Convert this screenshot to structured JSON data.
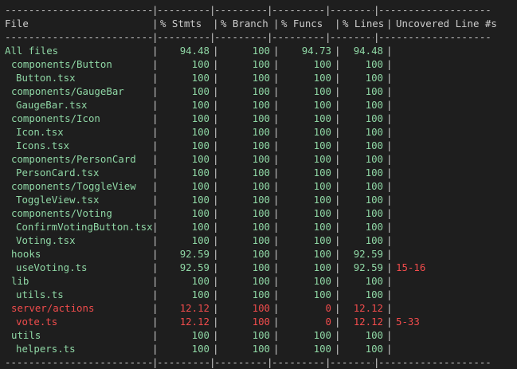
{
  "colors": {
    "background": "#1e1e1e",
    "default_text": "#cccccc",
    "covered": "#8fd7a5",
    "uncovered": "#f14c4c"
  },
  "table": {
    "separator": {
      "file": "--------------------------",
      "stmts": "---------",
      "branch": "----------",
      "funcs": "---------",
      "lines": "---------",
      "uncovered": "-------------------"
    },
    "headers": {
      "file": "File",
      "stmts": "% Stmts",
      "branch": "% Branch",
      "funcs": "% Funcs",
      "lines": "% Lines",
      "uncovered": "Uncovered Line #s"
    },
    "rows": [
      {
        "file": "All files",
        "indent": 0,
        "stmts": "94.48",
        "branch": "100",
        "funcs": "94.73",
        "lines": "94.48",
        "uncovered": "",
        "status": "ok"
      },
      {
        "file": "components/Button",
        "indent": 1,
        "stmts": "100",
        "branch": "100",
        "funcs": "100",
        "lines": "100",
        "uncovered": "",
        "status": "ok"
      },
      {
        "file": "Button.tsx",
        "indent": 2,
        "stmts": "100",
        "branch": "100",
        "funcs": "100",
        "lines": "100",
        "uncovered": "",
        "status": "ok"
      },
      {
        "file": "components/GaugeBar",
        "indent": 1,
        "stmts": "100",
        "branch": "100",
        "funcs": "100",
        "lines": "100",
        "uncovered": "",
        "status": "ok"
      },
      {
        "file": "GaugeBar.tsx",
        "indent": 2,
        "stmts": "100",
        "branch": "100",
        "funcs": "100",
        "lines": "100",
        "uncovered": "",
        "status": "ok"
      },
      {
        "file": "components/Icon",
        "indent": 1,
        "stmts": "100",
        "branch": "100",
        "funcs": "100",
        "lines": "100",
        "uncovered": "",
        "status": "ok"
      },
      {
        "file": "Icon.tsx",
        "indent": 2,
        "stmts": "100",
        "branch": "100",
        "funcs": "100",
        "lines": "100",
        "uncovered": "",
        "status": "ok"
      },
      {
        "file": "Icons.tsx",
        "indent": 2,
        "stmts": "100",
        "branch": "100",
        "funcs": "100",
        "lines": "100",
        "uncovered": "",
        "status": "ok"
      },
      {
        "file": "components/PersonCard",
        "indent": 1,
        "stmts": "100",
        "branch": "100",
        "funcs": "100",
        "lines": "100",
        "uncovered": "",
        "status": "ok"
      },
      {
        "file": "PersonCard.tsx",
        "indent": 2,
        "stmts": "100",
        "branch": "100",
        "funcs": "100",
        "lines": "100",
        "uncovered": "",
        "status": "ok"
      },
      {
        "file": "components/ToggleView",
        "indent": 1,
        "stmts": "100",
        "branch": "100",
        "funcs": "100",
        "lines": "100",
        "uncovered": "",
        "status": "ok"
      },
      {
        "file": "ToggleView.tsx",
        "indent": 2,
        "stmts": "100",
        "branch": "100",
        "funcs": "100",
        "lines": "100",
        "uncovered": "",
        "status": "ok"
      },
      {
        "file": "components/Voting",
        "indent": 1,
        "stmts": "100",
        "branch": "100",
        "funcs": "100",
        "lines": "100",
        "uncovered": "",
        "status": "ok"
      },
      {
        "file": "ConfirmVotingButton.tsx",
        "indent": 2,
        "stmts": "100",
        "branch": "100",
        "funcs": "100",
        "lines": "100",
        "uncovered": "",
        "status": "ok"
      },
      {
        "file": "Voting.tsx",
        "indent": 2,
        "stmts": "100",
        "branch": "100",
        "funcs": "100",
        "lines": "100",
        "uncovered": "",
        "status": "ok"
      },
      {
        "file": "hooks",
        "indent": 1,
        "stmts": "92.59",
        "branch": "100",
        "funcs": "100",
        "lines": "92.59",
        "uncovered": "",
        "status": "ok"
      },
      {
        "file": "useVoting.ts",
        "indent": 2,
        "stmts": "92.59",
        "branch": "100",
        "funcs": "100",
        "lines": "92.59",
        "uncovered": "15-16",
        "status": "ok"
      },
      {
        "file": "lib",
        "indent": 1,
        "stmts": "100",
        "branch": "100",
        "funcs": "100",
        "lines": "100",
        "uncovered": "",
        "status": "ok"
      },
      {
        "file": "utils.ts",
        "indent": 2,
        "stmts": "100",
        "branch": "100",
        "funcs": "100",
        "lines": "100",
        "uncovered": "",
        "status": "ok"
      },
      {
        "file": "server/actions",
        "indent": 1,
        "stmts": "12.12",
        "branch": "100",
        "funcs": "0",
        "lines": "12.12",
        "uncovered": "",
        "status": "bad"
      },
      {
        "file": "vote.ts",
        "indent": 2,
        "stmts": "12.12",
        "branch": "100",
        "funcs": "0",
        "lines": "12.12",
        "uncovered": "5-33",
        "status": "bad"
      },
      {
        "file": "utils",
        "indent": 1,
        "stmts": "100",
        "branch": "100",
        "funcs": "100",
        "lines": "100",
        "uncovered": "",
        "status": "ok"
      },
      {
        "file": "helpers.ts",
        "indent": 2,
        "stmts": "100",
        "branch": "100",
        "funcs": "100",
        "lines": "100",
        "uncovered": "",
        "status": "ok"
      }
    ]
  }
}
